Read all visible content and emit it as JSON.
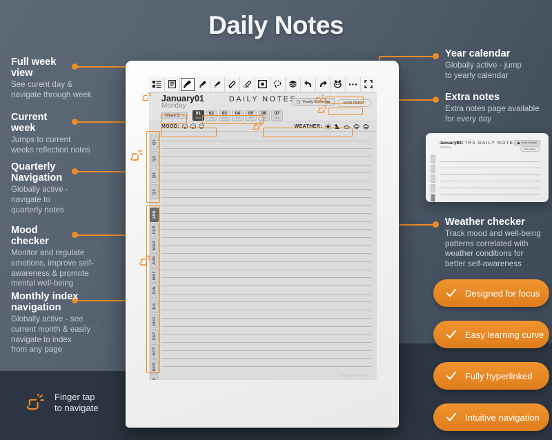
{
  "page": {
    "title": "Daily Notes",
    "bg_top": "#5d6876",
    "bg_bottom": "#2c3541",
    "accent": "#ef8a28"
  },
  "annotations_left": [
    {
      "id": "full-week-view",
      "title": "Full week\nview",
      "desc": "See curent day &\nnavigate through week"
    },
    {
      "id": "current-week",
      "title": "Current\nweek",
      "desc": "Jumps to current\nweeks reflection notes"
    },
    {
      "id": "quarterly-navigation",
      "title": "Quarterly\nNavigation",
      "desc": "Globally active -\nnavigate to\nquarterly notes"
    },
    {
      "id": "mood-checker",
      "title": "Mood\nchecker",
      "desc": "Monitor and regulate\nemotions, improve self-\nawareness & promote\nmental well-being"
    },
    {
      "id": "monthly-index-navigation",
      "title": "Monthly index\nnavigation",
      "desc": "Globally active - see\ncurrent month & easily\nnavigate to index\nfrom any page"
    }
  ],
  "annotations_right": [
    {
      "id": "year-calendar",
      "title": "Year calendar",
      "desc": "Globally active - jump\nto yearly calendar"
    },
    {
      "id": "extra-notes",
      "title": "Extra notes",
      "desc": "Extra notes page available\nfor every day"
    },
    {
      "id": "weather-checker",
      "title": "Weather checker",
      "desc": "Track mood and well-being\npatterns correlated with\nweather conditions for\nbetter self-awareness"
    }
  ],
  "legend": {
    "icon": "finger-tap-icon",
    "text": "Finger tap\nto navigate"
  },
  "pills": [
    {
      "label": "Designed for focus",
      "icon": "check-icon"
    },
    {
      "label": "Easy learning curve",
      "icon": "check-icon"
    },
    {
      "label": "Fully hyperlinked",
      "icon": "check-icon"
    },
    {
      "label": "Intuitive navigation",
      "icon": "check-icon"
    }
  ],
  "tablet": {
    "toolbar": [
      {
        "name": "layout-list-icon",
        "selected": false
      },
      {
        "name": "text-lines-icon",
        "selected": false
      },
      {
        "name": "pen-thick-icon",
        "selected": true
      },
      {
        "name": "pen-medium-icon",
        "selected": false
      },
      {
        "name": "pen-thin-icon",
        "selected": false
      },
      {
        "name": "eraser-icon",
        "selected": false
      },
      {
        "name": "eraser-area-icon",
        "selected": false
      },
      {
        "name": "select-frame-icon",
        "selected": false
      },
      {
        "name": "lasso-icon",
        "selected": false
      },
      {
        "name": "layers-icon",
        "selected": false
      },
      {
        "name": "undo-icon",
        "selected": false
      },
      {
        "name": "redo-icon",
        "selected": false
      },
      {
        "name": "shapes-icon",
        "selected": false
      },
      {
        "name": "more-icon",
        "selected": false
      },
      {
        "name": "fullscreen-icon",
        "selected": false
      }
    ],
    "header": {
      "date": "January01",
      "weekday": "Monday",
      "page_title": "DAILY NOTES",
      "week_label": "Week 1",
      "week_next": "›",
      "yearly_calendar_label": "Yearly Calendar",
      "extra_notes_label": "Extra Notes ›"
    },
    "days": [
      {
        "num": "01",
        "wd": "Mon",
        "active": true
      },
      {
        "num": "02",
        "wd": "Tue",
        "active": false
      },
      {
        "num": "03",
        "wd": "Wed",
        "active": false
      },
      {
        "num": "04",
        "wd": "Thu",
        "active": false
      },
      {
        "num": "05",
        "wd": "Fri",
        "active": false
      },
      {
        "num": "06",
        "wd": "Sat",
        "active": false
      },
      {
        "num": "07",
        "wd": "Sun",
        "active": false
      }
    ],
    "mood": {
      "label": "MOOD:",
      "icons": [
        "face-happy-icon",
        "face-neutral-icon",
        "face-sad-icon"
      ]
    },
    "weather": {
      "label": "WEATHER:",
      "icons": [
        "sun-icon",
        "partly-cloudy-icon",
        "cloud-icon",
        "rain-icon",
        "storm-icon"
      ]
    },
    "quarter_tabs": [
      {
        "label": "Q1",
        "active": false
      },
      {
        "label": "Q2",
        "active": false
      },
      {
        "label": "Q3",
        "active": false
      },
      {
        "label": "Q4",
        "active": false
      }
    ],
    "month_tabs": [
      {
        "label": "JAN",
        "active": true
      },
      {
        "label": "FEB",
        "active": false
      },
      {
        "label": "MAR",
        "active": false
      },
      {
        "label": "APR",
        "active": false
      },
      {
        "label": "MAY",
        "active": false
      },
      {
        "label": "JUN",
        "active": false
      },
      {
        "label": "JUL",
        "active": false
      },
      {
        "label": "AUG",
        "active": false
      },
      {
        "label": "SEP",
        "active": false
      },
      {
        "label": "OCT",
        "active": false
      },
      {
        "label": "NOV",
        "active": false
      },
      {
        "label": "DEC",
        "active": false
      }
    ],
    "watermark": "DailyNotesPlanner",
    "note_line_count": 29
  },
  "preview": {
    "date": "January01",
    "weekday": "Sunday",
    "title": "EXTRA DAILY NOTES",
    "yearly_calendar_label": "Yearly Calendar",
    "extra_notes_label": "Daily Notes ›",
    "line_count": 6,
    "tabs": [
      {
        "label": "Q1",
        "active": false
      },
      {
        "label": "Q2",
        "active": false
      },
      {
        "label": "Q3",
        "active": false
      },
      {
        "label": "Q4",
        "active": false
      },
      {
        "label": "JAN",
        "active": true
      }
    ]
  }
}
